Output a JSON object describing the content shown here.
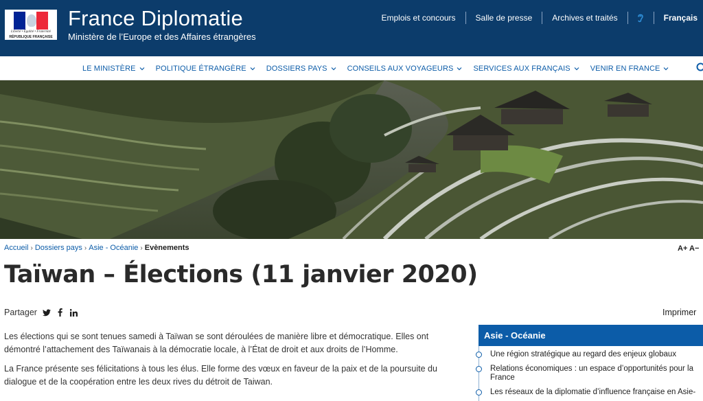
{
  "header": {
    "logo": {
      "motto": "Liberté • Égalité • Fraternité",
      "republic": "RÉPUBLIQUE FRANÇAISE"
    },
    "site_title": "France Diplomatie",
    "site_subtitle": "Ministère de l’Europe et des Affaires étrangères",
    "top_links": [
      "Emplois et concours",
      "Salle de presse",
      "Archives et traités"
    ],
    "accessibility_icon": "ear-icon",
    "language": "Français"
  },
  "nav": {
    "items": [
      "LE MINISTÈRE",
      "POLITIQUE ÉTRANGÈRE",
      "DOSSIERS PAYS",
      "CONSEILS AUX VOYAGEURS",
      "SERVICES AUX FRANÇAIS",
      "VENIR EN FRANCE"
    ],
    "search_icon": "search-icon"
  },
  "breadcrumb": {
    "items": [
      "Accueil",
      "Dossiers pays",
      "Asie - Océanie"
    ],
    "current": "Evènements"
  },
  "font_controls": "A+ A−",
  "page_title": "Taïwan – Élections (11 janvier 2020)",
  "share": {
    "label": "Partager",
    "icons": [
      "twitter-icon",
      "facebook-icon",
      "linkedin-icon"
    ]
  },
  "print_label": "Imprimer",
  "content": {
    "paragraphs": [
      "Les élections qui se sont tenues samedi à Taïwan se sont déroulées de manière libre et démocratique. Elles ont démontré l’attachement des Taïwanais à la démocratie locale, à l’État de droit et aux droits de l’Homme.",
      "La France présente ses félicitations à tous les élus. Elle forme des vœux en faveur de la paix et de la poursuite du dialogue et de la coopération entre les deux rives du détroit de Taiwan."
    ]
  },
  "sidebar": {
    "title": "Asie - Océanie",
    "items": [
      "Une région stratégique au regard des enjeux globaux",
      "Relations économiques : un espace d’opportunités pour la France",
      "Les réseaux de la diplomatie d’influence française en Asie-"
    ]
  },
  "colors": {
    "header_bg": "#0c3c6b",
    "link_blue": "#0c5ca8",
    "sidebar_head_bg": "#0c5ca8"
  }
}
